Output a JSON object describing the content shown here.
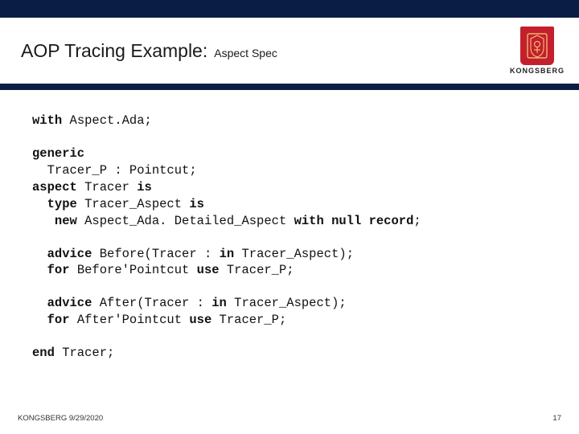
{
  "title": {
    "main": "AOP Tracing Example:",
    "sub": "Aspect Spec"
  },
  "brand": {
    "name": "KONGSBERG",
    "icon": "crest-icon"
  },
  "code": {
    "l1": {
      "k1": "with",
      "t1": " Aspect.Ada;"
    },
    "l2": {
      "k1": "generic"
    },
    "l3": {
      "t1": "  Tracer_P : Pointcut;"
    },
    "l4": {
      "k1": "aspect",
      "t1": " Tracer ",
      "k2": "is"
    },
    "l5": {
      "k1": "  type",
      "t1": " Tracer_Aspect ",
      "k2": "is"
    },
    "l6": {
      "k1": "   new",
      "t1": " Aspect_Ada. Detailed_Aspect ",
      "k2": "with null record",
      "t2": ";"
    },
    "l7": {
      "k1": "  advice",
      "t1": " Before(Tracer : ",
      "k2": "in",
      "t2": " Tracer_Aspect);"
    },
    "l8": {
      "k1": "  for",
      "t1": " Before'Pointcut ",
      "k2": "use",
      "t2": " Tracer_P;"
    },
    "l9": {
      "k1": "  advice",
      "t1": " After(Tracer : ",
      "k2": "in",
      "t2": " Tracer_Aspect);"
    },
    "l10": {
      "k1": "  for",
      "t1": " After'Pointcut ",
      "k2": "use",
      "t2": " Tracer_P;"
    },
    "l11": {
      "k1": "end",
      "t1": " Tracer;"
    }
  },
  "footer": {
    "left": "KONGSBERG 9/29/2020",
    "right": "17"
  }
}
